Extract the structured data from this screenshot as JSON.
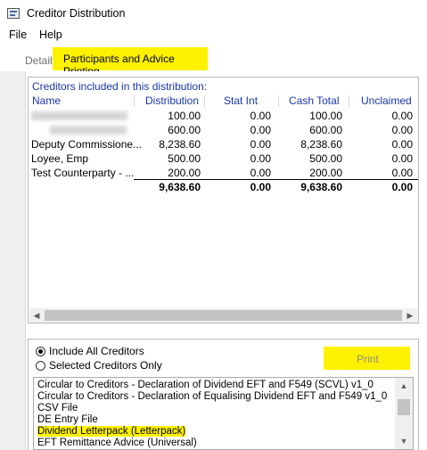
{
  "window": {
    "title": "Creditor Distribution"
  },
  "menu": {
    "items": [
      "File",
      "Help"
    ]
  },
  "tabs": {
    "details": "Details",
    "active": "Participants and Advice Printing"
  },
  "grid": {
    "caption": "Creditors included in this distribution:",
    "columns": [
      "Name",
      "Distribution",
      "Stat Int",
      "Cash Total",
      "Unclaimed"
    ],
    "rows": [
      [
        "",
        "100.00",
        "0.00",
        "100.00",
        "0.00"
      ],
      [
        "",
        "600.00",
        "0.00",
        "600.00",
        "0.00"
      ],
      [
        "Deputy Commissione...",
        "8,238.60",
        "0.00",
        "8,238.60",
        "0.00"
      ],
      [
        "Loyee, Emp",
        "500.00",
        "0.00",
        "500.00",
        "0.00"
      ],
      [
        "Test Counterparty - ...",
        "200.00",
        "0.00",
        "200.00",
        "0.00"
      ]
    ],
    "totals": [
      "9,638.60",
      "0.00",
      "9,638.60",
      "0.00"
    ]
  },
  "options": {
    "include_all": {
      "label": "Include All Creditors",
      "checked": true
    },
    "selected_only": {
      "label": "Selected Creditors Only",
      "checked": false
    }
  },
  "print_button": {
    "label": "Print",
    "enabled": false
  },
  "templates": {
    "items": [
      "Circular to Creditors - Declaration of Dividend EFT and F549 (SCVL) v1_0",
      "Circular to Creditors - Declaration of Equalising Dividend EFT and F549 v1_0",
      "CSV File",
      "DE Entry File",
      "Dividend Letterpack (Letterpack)",
      "EFT Remittance Advice (Universal)"
    ],
    "selected_index": 4
  },
  "colors": {
    "highlight": "#fff200",
    "header_text": "#1a36a8"
  }
}
